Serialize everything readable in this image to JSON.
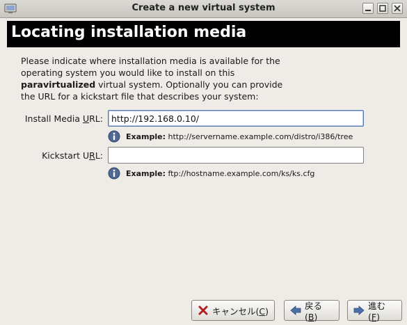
{
  "window": {
    "title": "Create a new virtual system"
  },
  "banner": {
    "title": "Locating installation media"
  },
  "description": {
    "line1": "Please indicate where installation media is available for the",
    "line2": "operating system you would like to install on this",
    "bold": "paravirtualized",
    "line3_rest": " virtual system. Optionally you can provide",
    "line4": "the URL for a kickstart file that describes your system:"
  },
  "form": {
    "media_label_pre": "Install Media ",
    "media_label_ul": "U",
    "media_label_post": "RL:",
    "media_value": "http://192.168.0.10/",
    "media_hint_bold": "Example:",
    "media_hint_text": " http://servername.example.com/distro/i386/tree",
    "ks_label_pre": "Kickstart U",
    "ks_label_ul": "R",
    "ks_label_post": "L:",
    "ks_value": "",
    "ks_hint_bold": "Example:",
    "ks_hint_text": " ftp://hostname.example.com/ks/ks.cfg"
  },
  "buttons": {
    "cancel_pre": "キャンセル(",
    "cancel_key": "C",
    "cancel_post": ")",
    "back_pre": "戻る(",
    "back_key": "B",
    "back_post": ")",
    "forward_pre": "進む(",
    "forward_key": "F",
    "forward_post": ")"
  },
  "colors": {
    "banner_bg": "#000000",
    "window_bg": "#efebe7",
    "info_blue": "#4e6a94"
  }
}
